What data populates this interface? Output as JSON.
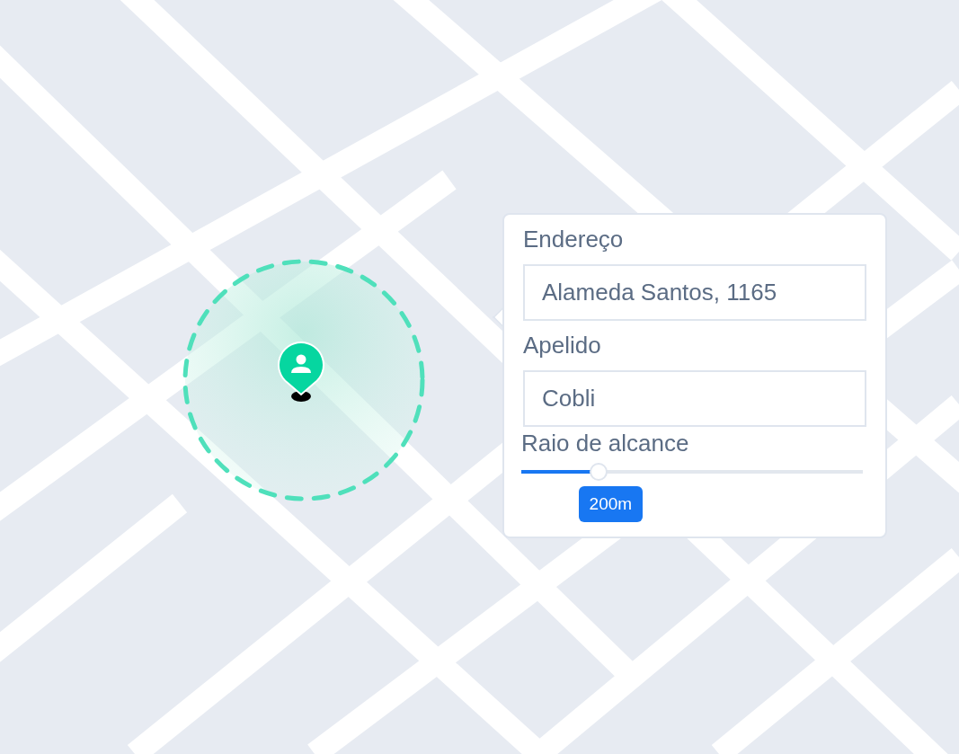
{
  "radius_popup": {
    "fields": [
      {
        "label": "Endereço",
        "value": "Alameda Santos, 1165"
      },
      {
        "label": "Apelido",
        "value": "Cobli"
      }
    ],
    "slider": {
      "label": "Raio de alcance",
      "level": 0.22,
      "reading": "200m"
    }
  }
}
